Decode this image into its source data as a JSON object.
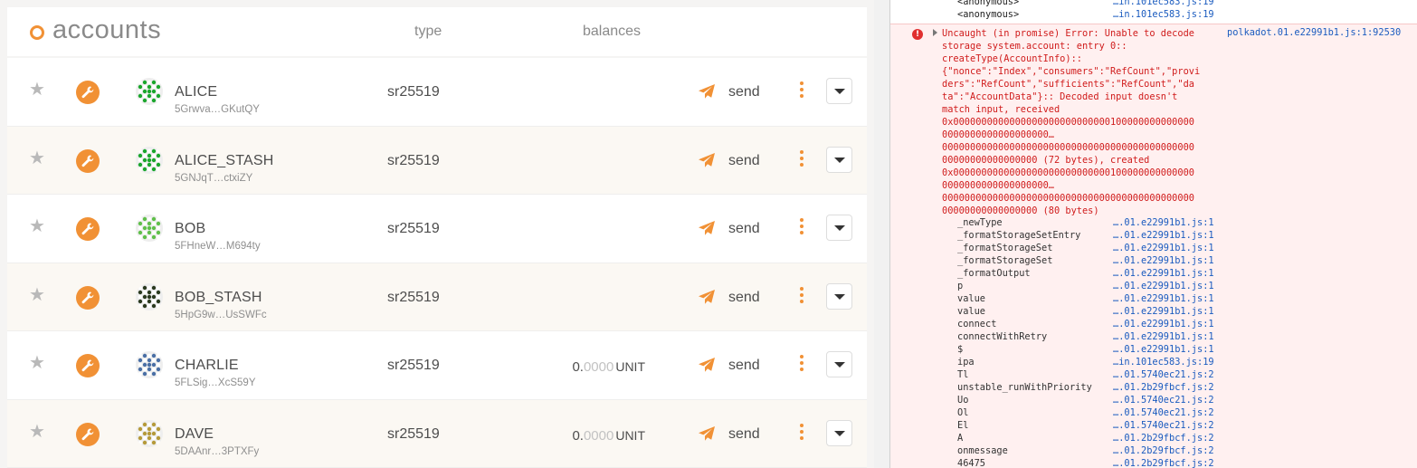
{
  "header": {
    "title": "accounts",
    "col_type": "type",
    "col_balances": "balances"
  },
  "accounts": [
    {
      "name": "ALICE",
      "address": "5Grwva…GKutQY",
      "type": "sr25519",
      "balance_int": "",
      "balance_frac": "",
      "balance_unit": "",
      "send_label": "send",
      "identicon_color": "#1aa62c"
    },
    {
      "name": "ALICE_STASH",
      "address": "5GNJqT…ctxiZY",
      "type": "sr25519",
      "balance_int": "",
      "balance_frac": "",
      "balance_unit": "",
      "send_label": "send",
      "identicon_color": "#1aa62c"
    },
    {
      "name": "BOB",
      "address": "5FHneW…M694ty",
      "type": "sr25519",
      "balance_int": "",
      "balance_frac": "",
      "balance_unit": "",
      "send_label": "send",
      "identicon_color": "#5fbf4a"
    },
    {
      "name": "BOB_STASH",
      "address": "5HpG9w…UsSWFc",
      "type": "sr25519",
      "balance_int": "",
      "balance_frac": "",
      "balance_unit": "",
      "send_label": "send",
      "identicon_color": "#2b3a20"
    },
    {
      "name": "CHARLIE",
      "address": "5FLSig…XcS59Y",
      "type": "sr25519",
      "balance_int": "0.",
      "balance_frac": "0000",
      "balance_unit": "UNIT",
      "send_label": "send",
      "identicon_color": "#4a6fa5"
    },
    {
      "name": "DAVE",
      "address": "5DAAnr…3PTXFy",
      "type": "sr25519",
      "balance_int": "0.",
      "balance_frac": "0000",
      "balance_unit": "UNIT",
      "send_label": "send",
      "identicon_color": "#b59a3a"
    }
  ],
  "console": {
    "anon_lines": [
      {
        "fn": "<anonymous>",
        "src": "…in.101ec583.js:19"
      },
      {
        "fn": "<anonymous>",
        "src": "…in.101ec583.js:19"
      }
    ],
    "error_icon": "!",
    "error_source": "polkadot.01.e22991b1.js:1:92530",
    "error_message": "Uncaught (in promise) Error: Unable to decode\nstorage system.account: entry 0::\ncreateType(AccountInfo)::\n{\"nonce\":\"Index\",\"consumers\":\"RefCount\",\"provi\nders\":\"RefCount\",\"sufficients\":\"RefCount\",\"da\nta\":\"AccountData\"}:: Decoded input doesn't\nmatch input, received\n0x0000000000000000000000000000100000000000000\n0000000000000000000…\n000000000000000000000000000000000000000000000\n00000000000000000 (72 bytes), created\n0x0000000000000000000000000000100000000000000\n0000000000000000000…\n000000000000000000000000000000000000000000000\n00000000000000000 (80 bytes)",
    "frames": [
      {
        "fn": "_newType",
        "src": "….01.e22991b1.js:1"
      },
      {
        "fn": "_formatStorageSetEntry",
        "src": "….01.e22991b1.js:1"
      },
      {
        "fn": "_formatStorageSet",
        "src": "….01.e22991b1.js:1"
      },
      {
        "fn": "_formatStorageSet",
        "src": "….01.e22991b1.js:1"
      },
      {
        "fn": "_formatOutput",
        "src": "….01.e22991b1.js:1"
      },
      {
        "fn": "p",
        "src": "….01.e22991b1.js:1"
      },
      {
        "fn": "value",
        "src": "….01.e22991b1.js:1"
      },
      {
        "fn": "value",
        "src": "….01.e22991b1.js:1"
      },
      {
        "fn": "connect",
        "src": "….01.e22991b1.js:1"
      },
      {
        "fn": "connectWithRetry",
        "src": "….01.e22991b1.js:1"
      },
      {
        "fn": "$",
        "src": "….01.e22991b1.js:1"
      },
      {
        "fn": "ipa",
        "src": "…in.101ec583.js:19"
      },
      {
        "fn": "Tl",
        "src": "….01.5740ec21.js:2"
      },
      {
        "fn": "unstable_runWithPriority",
        "src": "….01.2b29fbcf.js:2"
      },
      {
        "fn": "Uo",
        "src": "….01.5740ec21.js:2"
      },
      {
        "fn": "Ol",
        "src": "….01.5740ec21.js:2"
      },
      {
        "fn": "El",
        "src": "….01.5740ec21.js:2"
      },
      {
        "fn": "A",
        "src": "….01.2b29fbcf.js:2"
      },
      {
        "fn": "onmessage",
        "src": "….01.2b29fbcf.js:2"
      },
      {
        "fn": "46475",
        "src": "….01.2b29fbcf.js:2"
      }
    ]
  },
  "colors": {
    "accent": "#f19135",
    "error_text": "#d01c1c",
    "error_bg": "#fff0f0",
    "link": "#1a5bbf"
  }
}
